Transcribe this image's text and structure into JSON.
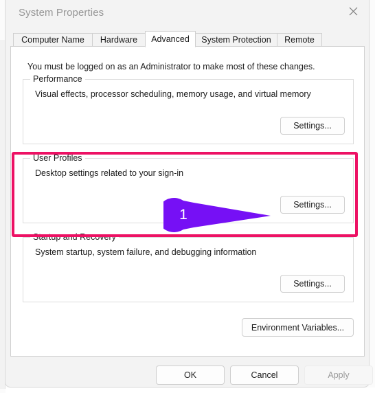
{
  "window": {
    "title": "System Properties",
    "close_icon": "close-icon"
  },
  "tabs": [
    {
      "label": "Computer Name",
      "selected": false
    },
    {
      "label": "Hardware",
      "selected": false
    },
    {
      "label": "Advanced",
      "selected": true
    },
    {
      "label": "System Protection",
      "selected": false
    },
    {
      "label": "Remote",
      "selected": false
    }
  ],
  "panel": {
    "admin_note": "You must be logged on as an Administrator to make most of these changes.",
    "groups": [
      {
        "label": "Performance",
        "description": "Visual effects, processor scheduling, memory usage, and virtual memory",
        "button_label": "Settings..."
      },
      {
        "label": "User Profiles",
        "description": "Desktop settings related to your sign-in",
        "button_label": "Settings..."
      },
      {
        "label": "Startup and Recovery",
        "description": "System startup, system failure, and debugging information",
        "button_label": "Settings..."
      }
    ],
    "environment_variables_label": "Environment Variables..."
  },
  "footer": {
    "ok_label": "OK",
    "cancel_label": "Cancel",
    "apply_label": "Apply",
    "apply_disabled": true
  },
  "annotations": {
    "highlight_color": "#ed1164",
    "callout_color": "#7610f5",
    "callout_number": "1",
    "highlight_target": "User Profiles",
    "callout_target": "User Profiles Settings button"
  }
}
